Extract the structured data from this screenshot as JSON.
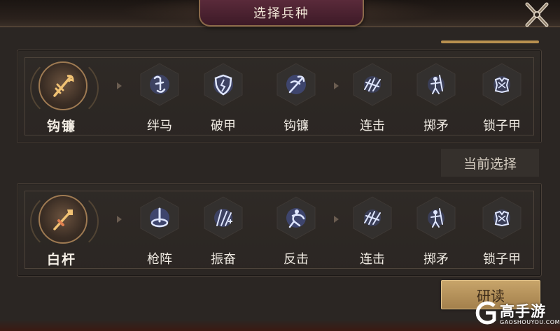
{
  "header": {
    "title": "选择兵种"
  },
  "close_icon": "close-x-icon",
  "selected_label": "当前选择",
  "study_button": "研读",
  "colors": {
    "gold": "#b8904f",
    "skill_glow": "#6f8dff",
    "title_plate": "#4a2030"
  },
  "units": [
    {
      "name": "钩镰",
      "icon": "hook-sickle-icon",
      "skills": [
        {
          "label": "绊马",
          "icon": "trip-horse-icon"
        },
        {
          "label": "破甲",
          "icon": "broken-shield-icon"
        },
        {
          "label": "钩镰",
          "icon": "hook-sickle-skill-icon"
        },
        {
          "label": "连击",
          "icon": "combo-strike-icon"
        },
        {
          "label": "掷矛",
          "icon": "spear-throw-icon"
        },
        {
          "label": "锁子甲",
          "icon": "chainmail-icon"
        }
      ]
    },
    {
      "name": "白杆",
      "icon": "white-spear-icon",
      "skills": [
        {
          "label": "枪阵",
          "icon": "spear-formation-icon"
        },
        {
          "label": "振奋",
          "icon": "inspire-icon"
        },
        {
          "label": "反击",
          "icon": "counter-attack-icon"
        },
        {
          "label": "连击",
          "icon": "combo-strike-icon"
        },
        {
          "label": "掷矛",
          "icon": "spear-throw-icon"
        },
        {
          "label": "锁子甲",
          "icon": "chainmail-icon"
        }
      ]
    }
  ],
  "watermark": {
    "text": "高手游",
    "domain": "GAOSHOUYOU.COM"
  }
}
